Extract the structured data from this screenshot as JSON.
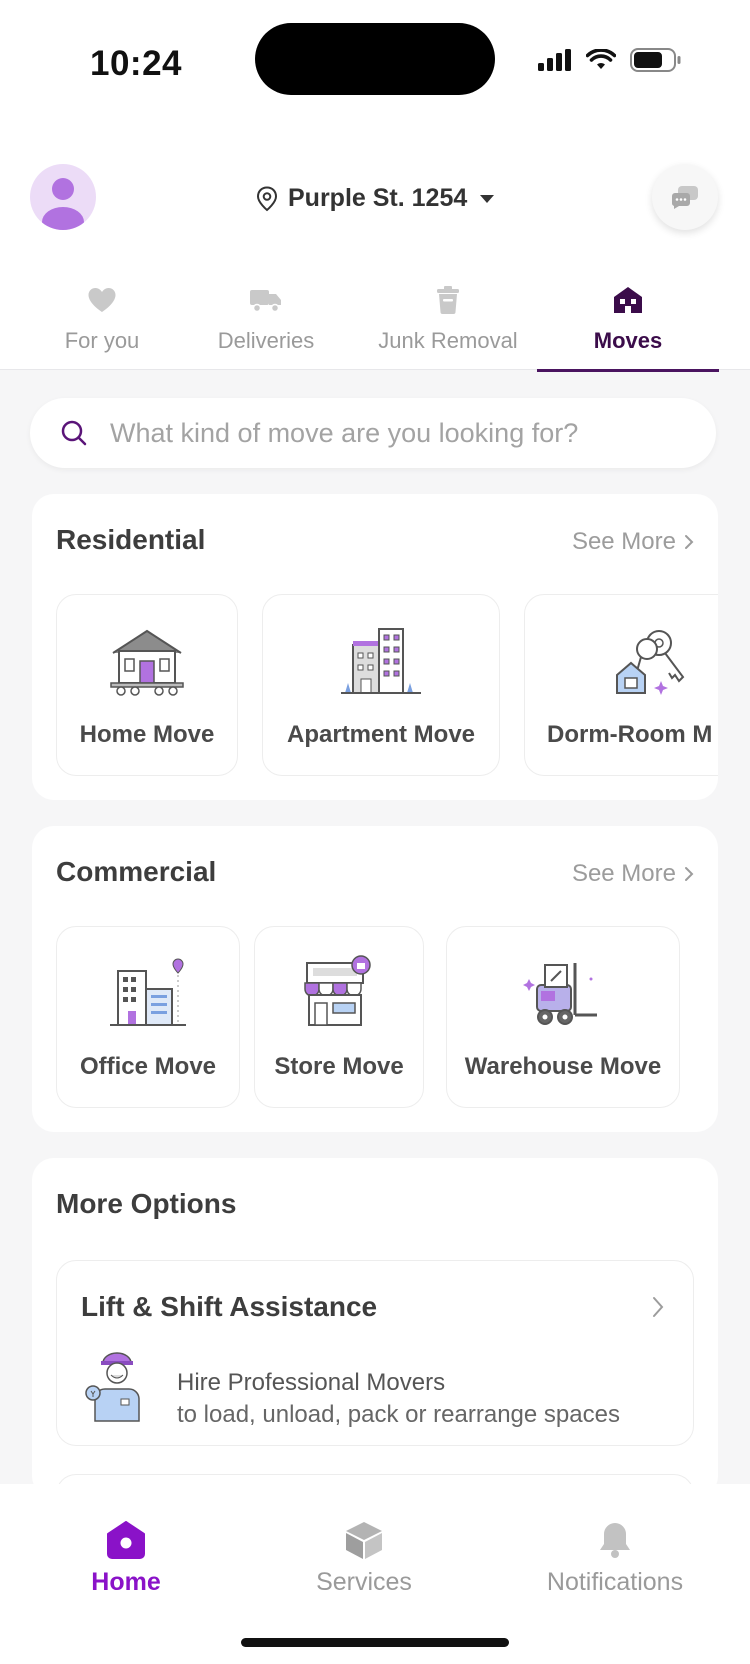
{
  "status_bar": {
    "time": "10:24"
  },
  "header": {
    "location": "Purple St. 1254",
    "icons": {
      "avatar": "user-avatar",
      "location": "map-pin-icon",
      "dropdown": "caret-down-icon",
      "chat": "chat-bubbles-icon"
    }
  },
  "tabs": [
    {
      "label": "For you",
      "icon": "heart-icon",
      "active": false
    },
    {
      "label": "Deliveries",
      "icon": "truck-icon",
      "active": false
    },
    {
      "label": "Junk Removal",
      "icon": "trash-icon",
      "active": false
    },
    {
      "label": "Moves",
      "icon": "house-icon",
      "active": true
    }
  ],
  "search": {
    "placeholder": "What kind of move are you looking for?"
  },
  "residential": {
    "title": "Residential",
    "see_more": "See More",
    "cards": [
      {
        "label": "Home Move",
        "icon": "house-on-truck-illustration"
      },
      {
        "label": "Apartment Move",
        "icon": "apartment-building-illustration"
      },
      {
        "label": "Dorm-Room M",
        "icon": "keys-illustration"
      }
    ]
  },
  "commercial": {
    "title": "Commercial",
    "see_more": "See More",
    "cards": [
      {
        "label": "Office Move",
        "icon": "office-building-illustration"
      },
      {
        "label": "Store Move",
        "icon": "storefront-illustration"
      },
      {
        "label": "Warehouse Move",
        "icon": "forklift-illustration"
      }
    ]
  },
  "more_options": {
    "title": "More Options",
    "items": [
      {
        "title": "Lift & Shift Assistance",
        "line1": "Hire Professional Movers",
        "line2": "to load, unload, pack or rearrange spaces",
        "icon": "mover-worker-illustration"
      }
    ]
  },
  "bottom_nav": [
    {
      "label": "Home",
      "icon": "home-icon",
      "active": true
    },
    {
      "label": "Services",
      "icon": "box-icon",
      "active": false
    },
    {
      "label": "Notifications",
      "icon": "bell-icon",
      "active": false
    }
  ],
  "colors": {
    "accent": "#8a12c8",
    "active_tab": "#3b0c4a",
    "lavender": "#b98ce6",
    "background": "#f6f6f7"
  }
}
